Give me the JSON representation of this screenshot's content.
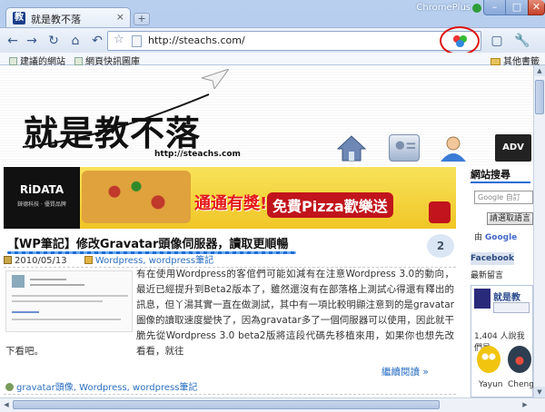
{
  "browser": {
    "tab_title": "就是教不落",
    "tab_close": "×",
    "new_tab": "+",
    "brand": "ChromePlus",
    "url": "http://steachs.com/",
    "window_min": "–",
    "window_max": "□",
    "window_close": "✕"
  },
  "toolbar": {
    "back": "←",
    "forward": "→",
    "reload": "↻",
    "home": "⌂",
    "history": "↶",
    "star": "☆",
    "page_menu": "▢",
    "wrench": "🔧"
  },
  "bookmarks": {
    "items": [
      {
        "label": "建議的網站"
      },
      {
        "label": "網頁快訊圖庫"
      }
    ],
    "other": "其他書籤"
  },
  "site": {
    "logo": "就是教不落",
    "logo_url": "http://steachs.com",
    "adv": "ADV"
  },
  "banner": {
    "brand": "RiDATA",
    "brand_sub": "錸德科技 · 優質品牌",
    "text1": "通通有獎!",
    "text2": "免費Pizza歡樂送"
  },
  "post": {
    "title": "【WP筆記】修改Gravatar頭像伺服器，讀取更順暢",
    "comments": "2",
    "date": "2010/05/13",
    "categories": "Wordpress, wordpress筆記",
    "body": "有在使用Wordpress的客倌們可能如減有在注意Wordpress 3.0的動向，最近已經提升到Beta2版本了，雖然還沒有在部落格上測試心得還有釋出的訊息，但丫湯其實一直在做測試，其中有一項比較明顯注意到的是gravatar圖像的讀取速度變快了，因為gravatar多了一個伺服器可以使用，因此就干脆先從Wordpress 3.0 beta2版將這段代碼先移植來用，如果你也想先改看看，就往",
    "body_cont": "下看吧。",
    "read_more": "繼續閱讀 »",
    "tags": "gravatar頭像, Wordpress, wordpress筆記"
  },
  "sidebar": {
    "title": "網站搜尋",
    "search_placeholder": "Google 自訂",
    "search_button": "請選取語言",
    "google_label": "由",
    "google_brand": "Google",
    "fb_tab": "Facebook",
    "latest_tab": "最新留言",
    "fb_name": "就是教",
    "fans_count": "1,404 人說我們是",
    "fan1": "Yayun",
    "fan2": "Cheng"
  }
}
